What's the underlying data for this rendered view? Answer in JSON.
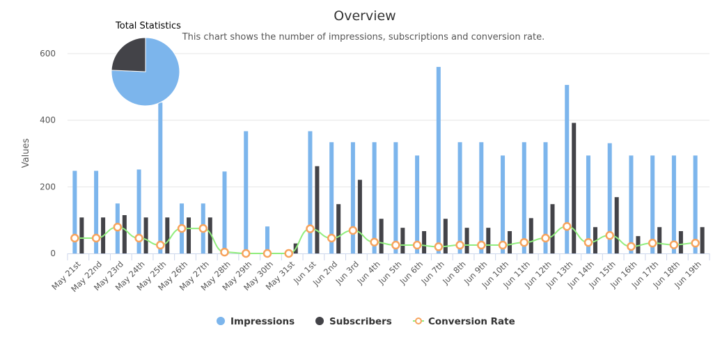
{
  "chart_data": {
    "type": "bar",
    "title": "Overview",
    "subtitle": "This chart shows the number of impressions, subscriptions and conversion rate.",
    "xlabel": "",
    "ylabel": "Values",
    "ylim": [
      0,
      600
    ],
    "yticks": [
      0,
      200,
      400,
      600
    ],
    "grid": true,
    "legend_position": "bottom",
    "categories": [
      "May 21st",
      "May 22nd",
      "May 23rd",
      "May 24th",
      "May 25th",
      "May 26th",
      "May 27th",
      "May 28th",
      "May 29th",
      "May 30th",
      "May 31st",
      "Jun 1st",
      "Jun 2nd",
      "Jun 3rd",
      "Jun 4th",
      "Jun 5th",
      "Jun 6th",
      "Jun 7th",
      "Jun 8th",
      "Jun 9th",
      "Jun 10th",
      "Jun 11th",
      "Jun 12th",
      "Jun 13th",
      "Jun 14th",
      "Jun 15th",
      "Jun 16th",
      "Jun 17th",
      "Jun 18th",
      "Jun 19th"
    ],
    "series": [
      {
        "name": "Impressions",
        "type": "bar",
        "color": "#7cb5ec",
        "values": [
          248,
          248,
          150,
          252,
          453,
          150,
          150,
          246,
          367,
          81,
          0,
          367,
          334,
          334,
          334,
          334,
          294,
          560,
          334,
          334,
          294,
          334,
          334,
          506,
          294,
          331,
          294,
          294,
          294,
          294
        ]
      },
      {
        "name": "Subscribers",
        "type": "bar",
        "color": "#434348",
        "values": [
          108,
          108,
          115,
          108,
          108,
          108,
          108,
          0,
          0,
          0,
          30,
          262,
          148,
          221,
          104,
          77,
          67,
          104,
          77,
          77,
          67,
          106,
          148,
          392,
          79,
          169,
          52,
          79,
          67,
          79
        ]
      },
      {
        "name": "Conversion Rate",
        "type": "line",
        "color": "#90ed7d",
        "marker_color": "#f7a35c",
        "values": [
          46,
          46,
          79,
          46,
          25,
          75,
          75,
          4,
          0,
          0,
          0,
          74,
          46,
          69,
          34,
          25,
          25,
          20,
          25,
          25,
          25,
          33,
          46,
          81,
          33,
          54,
          21,
          31,
          26,
          31
        ]
      }
    ],
    "pie": {
      "title": "Total Statistics",
      "slices": [
        {
          "name": "Impressions",
          "value": 9497,
          "color": "#7cb5ec"
        },
        {
          "name": "Subscribers",
          "value": 3047,
          "color": "#434348"
        }
      ]
    },
    "legend": [
      {
        "label": "Impressions",
        "symbol": "circle",
        "color": "#7cb5ec"
      },
      {
        "label": "Subscribers",
        "symbol": "circle",
        "color": "#434348"
      },
      {
        "label": "Conversion Rate",
        "symbol": "line-marker",
        "color": "#90ed7d",
        "marker_color": "#f7a35c"
      }
    ]
  }
}
